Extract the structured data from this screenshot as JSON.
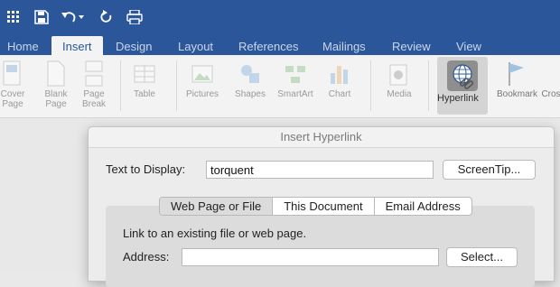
{
  "quick_access": {
    "icons": [
      "grid-icon",
      "save-icon",
      "undo-icon",
      "redo-icon",
      "print-icon"
    ]
  },
  "ribbon_tabs": [
    {
      "label": "Home",
      "active": false
    },
    {
      "label": "Insert",
      "active": true
    },
    {
      "label": "Design",
      "active": false
    },
    {
      "label": "Layout",
      "active": false
    },
    {
      "label": "References",
      "active": false
    },
    {
      "label": "Mailings",
      "active": false
    },
    {
      "label": "Review",
      "active": false
    },
    {
      "label": "View",
      "active": false
    }
  ],
  "ribbon": {
    "cover_page": "Cover Page",
    "blank_page": "Blank Page",
    "page_break": "Page Break",
    "table": "Table",
    "pictures": "Pictures",
    "shapes": "Shapes",
    "smartart": "SmartArt",
    "chart": "Chart",
    "media": "Media",
    "hyperlink": "Hyperlink",
    "bookmark": "Bookmark",
    "cross": "Cros"
  },
  "dialog": {
    "title": "Insert Hyperlink",
    "text_to_display_label": "Text to Display:",
    "text_to_display_value": "torquent",
    "screentip_button": "ScreenTip...",
    "segments": [
      "Web Page or File",
      "This Document",
      "Email Address"
    ],
    "hint": "Link to an existing file or web page.",
    "address_label": "Address:",
    "address_value": "",
    "select_button": "Select..."
  },
  "colors": {
    "brand": "#2b579a",
    "ribbon_bg": "#f3f3f3"
  }
}
